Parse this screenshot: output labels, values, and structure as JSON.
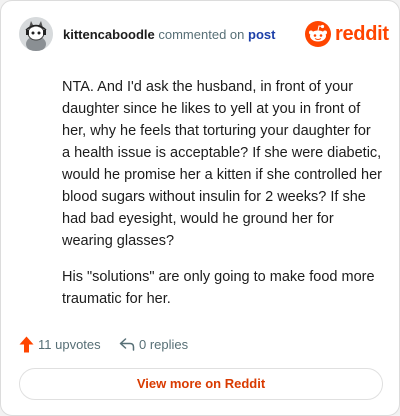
{
  "header": {
    "username": "kittencaboodle",
    "verb": "commented on",
    "post_link": "post",
    "brand": "reddit"
  },
  "comment": {
    "paragraphs": [
      "NTA. And I'd ask the husband, in front of your daughter since he likes to yell at you in front of her, why he feels that torturing your daughter for a health issue is acceptable? If she were diabetic, would he promise her a kitten if she controlled her blood sugars without insulin for 2 weeks? If she had bad eyesight, would he ground her for wearing glasses?",
      "His \"solutions\" are only going to make food more traumatic for her."
    ]
  },
  "actions": {
    "upvotes": "11 upvotes",
    "replies": "0 replies"
  },
  "footer": {
    "view_more": "View more on Reddit"
  },
  "colors": {
    "brand": "#ff4500",
    "link": "#1c3fa8",
    "button_text": "#d93a00"
  },
  "icons": [
    "avatar",
    "reddit-snoo-icon",
    "upvote-icon",
    "reply-icon"
  ]
}
